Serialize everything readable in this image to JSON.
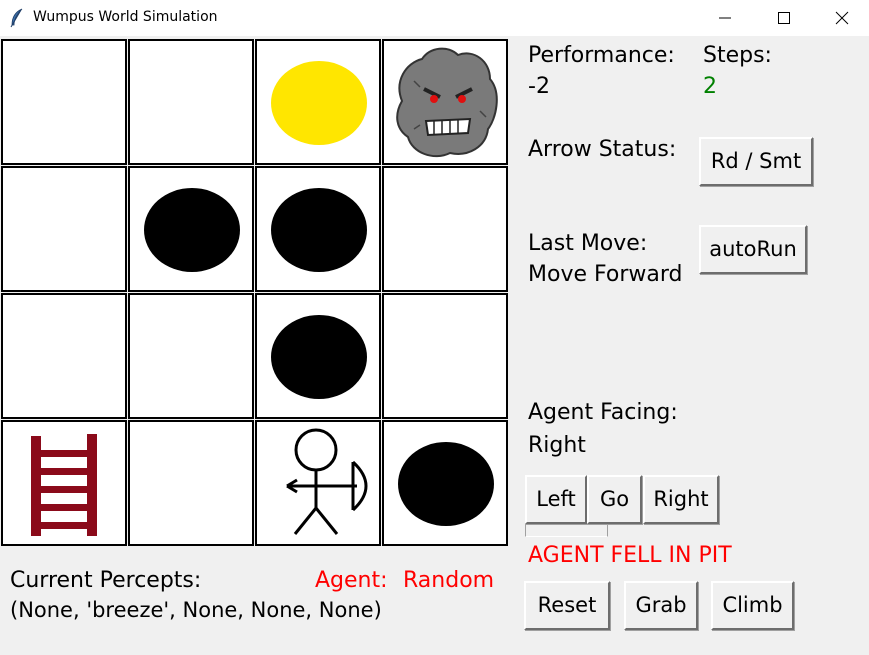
{
  "window": {
    "title": "Wumpus World Simulation",
    "icons": [
      "feather-icon",
      "minimize-icon",
      "maximize-icon",
      "close-icon"
    ]
  },
  "board": {
    "rows": [
      [
        "empty",
        "empty",
        "gold",
        "wumpus"
      ],
      [
        "empty",
        "pit",
        "pit",
        "empty"
      ],
      [
        "empty",
        "empty",
        "pit",
        "empty"
      ],
      [
        "ladder",
        "empty",
        "agent",
        "pit"
      ]
    ],
    "colors": {
      "gold": "#ffe600",
      "pit": "#000000",
      "ladder": "#8b0a1a",
      "wumpus": "#7a7a7a",
      "wumpus_eyes": "#e01010"
    }
  },
  "stats": {
    "performance_label": "Performance:",
    "performance_value": "-2",
    "steps_label": "Steps:",
    "steps_value": "2",
    "steps_color": "#008000",
    "arrow_status_label": "Arrow Status:",
    "last_move_label": "Last Move:",
    "last_move_value": "Move Forward",
    "agent_facing_label": "Agent Facing:",
    "agent_facing_value": "Right"
  },
  "buttons": {
    "rd_smt": "Rd / Smt",
    "autorun": "autoRun",
    "left": "Left",
    "go": "Go",
    "right": "Right",
    "reset": "Reset",
    "grab": "Grab",
    "climb": "Climb"
  },
  "status": {
    "message": "AGENT FELL IN PIT",
    "message_color": "#ff0000"
  },
  "percepts": {
    "label": "Current Percepts:",
    "value": "(None, 'breeze', None, None, None)",
    "agent_label": "Agent:",
    "agent_type": "Random",
    "agent_color": "#ff0000"
  }
}
